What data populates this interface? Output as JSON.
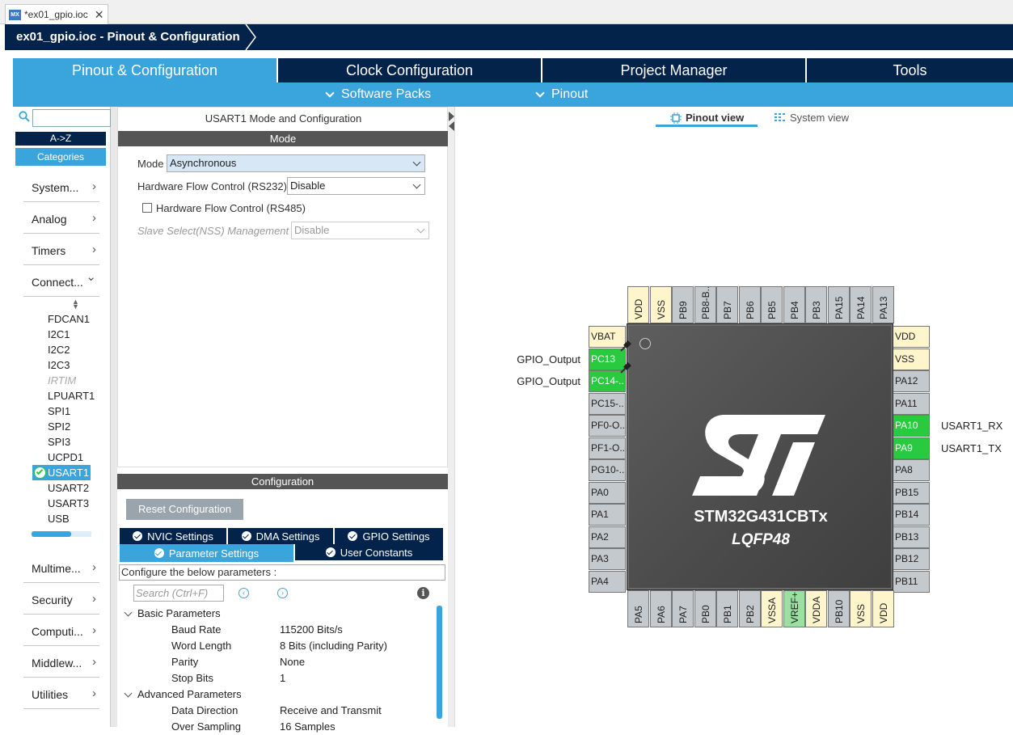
{
  "window": {
    "tab_title": "*ex01_gpio.ioc",
    "logo": "MX",
    "breadcrumb": "ex01_gpio.ioc - Pinout & Configuration"
  },
  "nav": {
    "tabs": [
      "Pinout & Configuration",
      "Clock Configuration",
      "Project Manager",
      "Tools"
    ],
    "active": 0,
    "sub": [
      "Software Packs",
      "Pinout"
    ]
  },
  "categories": {
    "search_value": "",
    "btn_az": "A->Z",
    "btn_categories": "Categories",
    "groups_top": [
      "System...",
      "Analog",
      "Timers",
      "Connect..."
    ],
    "connectivity_items": [
      "FDCAN1",
      "I2C1",
      "I2C2",
      "I2C3",
      "IRTIM",
      "LPUART1",
      "SPI1",
      "SPI2",
      "SPI3",
      "UCPD1",
      "USART1",
      "USART2",
      "USART3",
      "USB"
    ],
    "disabled_item": "IRTIM",
    "selected_item": "USART1",
    "groups_bottom": [
      "Multime...",
      "Security",
      "Computi...",
      "Middlew...",
      "Utilities"
    ]
  },
  "mode_panel": {
    "title": "USART1 Mode and Configuration",
    "section": "Mode",
    "mode_label": "Mode",
    "mode_value": "Asynchronous",
    "hfc232_label": "Hardware Flow Control (RS232)",
    "hfc232_value": "Disable",
    "hfc485_label": "Hardware Flow Control (RS485)",
    "hfc485_checked": false,
    "nss_label": "Slave Select(NSS) Management",
    "nss_value": "Disable"
  },
  "config_panel": {
    "section": "Configuration",
    "reset_label": "Reset Configuration",
    "tabs_row1": [
      "NVIC Settings",
      "DMA Settings",
      "GPIO Settings"
    ],
    "tabs_row2": [
      "Parameter Settings",
      "User Constants"
    ],
    "active_tab": "Parameter Settings",
    "description": "Configure the below parameters :",
    "search_placeholder": "Search (Ctrl+F)",
    "groups": [
      {
        "name": "Basic Parameters",
        "params": [
          [
            "Baud Rate",
            "115200 Bits/s"
          ],
          [
            "Word Length",
            "8 Bits (including Parity)"
          ],
          [
            "Parity",
            "None"
          ],
          [
            "Stop Bits",
            "1"
          ]
        ]
      },
      {
        "name": "Advanced Parameters",
        "params": [
          [
            "Data Direction",
            "Receive and Transmit"
          ],
          [
            "Over Sampling",
            "16 Samples"
          ]
        ]
      }
    ]
  },
  "view_tabs": {
    "pinout": "Pinout view",
    "system": "System view",
    "active": "pinout"
  },
  "chip": {
    "name": "STM32G431CBTx",
    "package": "LQFP48",
    "top_pins": [
      "VDD",
      "VSS",
      "PB9",
      "PB8-B..",
      "PB7",
      "PB6",
      "PB5",
      "PB4",
      "PB3",
      "PA15",
      "PA14",
      "PA13"
    ],
    "left_pins": [
      "VBAT",
      "PC13",
      "PC14-..",
      "PC15-..",
      "PF0-O..",
      "PF1-O..",
      "PG10-..",
      "PA0",
      "PA1",
      "PA2",
      "PA3",
      "PA4"
    ],
    "right_pins": [
      "VDD",
      "VSS",
      "PA12",
      "PA11",
      "PA10",
      "PA9",
      "PA8",
      "PB15",
      "PB14",
      "PB13",
      "PB12",
      "PB11"
    ],
    "bottom_pins": [
      "PA5",
      "PA6",
      "PA7",
      "PB0",
      "PB1",
      "PB2",
      "VSSA",
      "VREF+",
      "VDDA",
      "PB10",
      "VSS",
      "VDD"
    ],
    "power_pins": [
      "VDD",
      "VSS",
      "VBAT",
      "VSSA",
      "VDDA"
    ],
    "green_pins": [
      "PC13",
      "PC14-..",
      "PA10",
      "PA9"
    ],
    "light_green_pins": [
      "VREF+"
    ],
    "pin_labels": {
      "PC13": "GPIO_Output",
      "PC14-..": "GPIO_Output",
      "PA10": "USART1_RX",
      "PA9": "USART1_TX"
    },
    "colors": {
      "assigned": "#29c940",
      "power": "#fff5cc",
      "unused": "#c4c9cd",
      "accent": "#3aa4dc",
      "navy": "#03234b"
    }
  }
}
